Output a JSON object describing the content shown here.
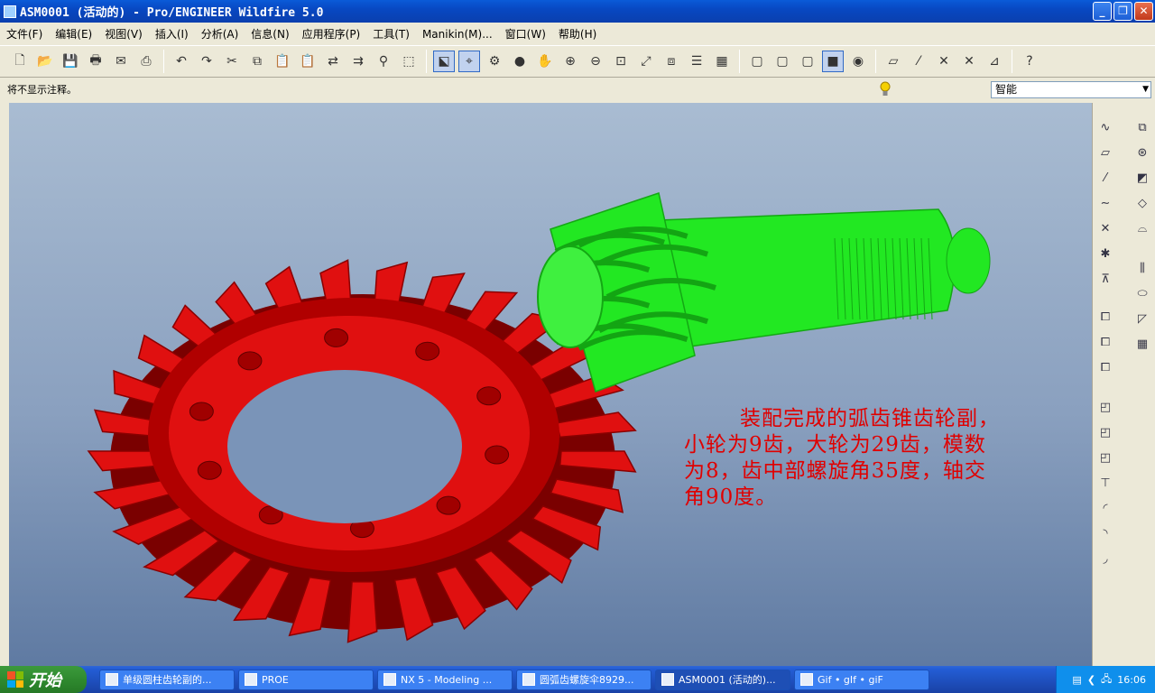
{
  "window": {
    "title": "ASM0001 (活动的) - Pro/ENGINEER Wildfire 5.0",
    "controls": [
      "minimize-icon",
      "restore-icon",
      "close-icon"
    ]
  },
  "menu": [
    "文件(F)",
    "编辑(E)",
    "视图(V)",
    "插入(I)",
    "分析(A)",
    "信息(N)",
    "应用程序(P)",
    "工具(T)",
    "Manikin(M)...",
    "窗口(W)",
    "帮助(H)"
  ],
  "status": {
    "message": "将不显示注释。",
    "filter_value": "智能"
  },
  "annotation": {
    "line1": "装配完成的弧齿锥齿轮副，",
    "line2": "小轮为9齿，大轮为29齿，模数",
    "line3": "为8，齿中部螺旋角35度，轴交",
    "line4": "角90度。"
  },
  "colors": {
    "gear_large": "#e01010",
    "gear_small": "#22e822",
    "annotation_text": "#e00000"
  },
  "taskbar": {
    "start_label": "开始",
    "tasks": [
      "单级圆柱齿轮副的...",
      "PROE",
      "NX 5 - Modeling ...",
      "圆弧齿螺旋伞8929...",
      "ASM0001 (活动的)...",
      "Gif • gIf • giF"
    ],
    "clock": "16:06"
  }
}
